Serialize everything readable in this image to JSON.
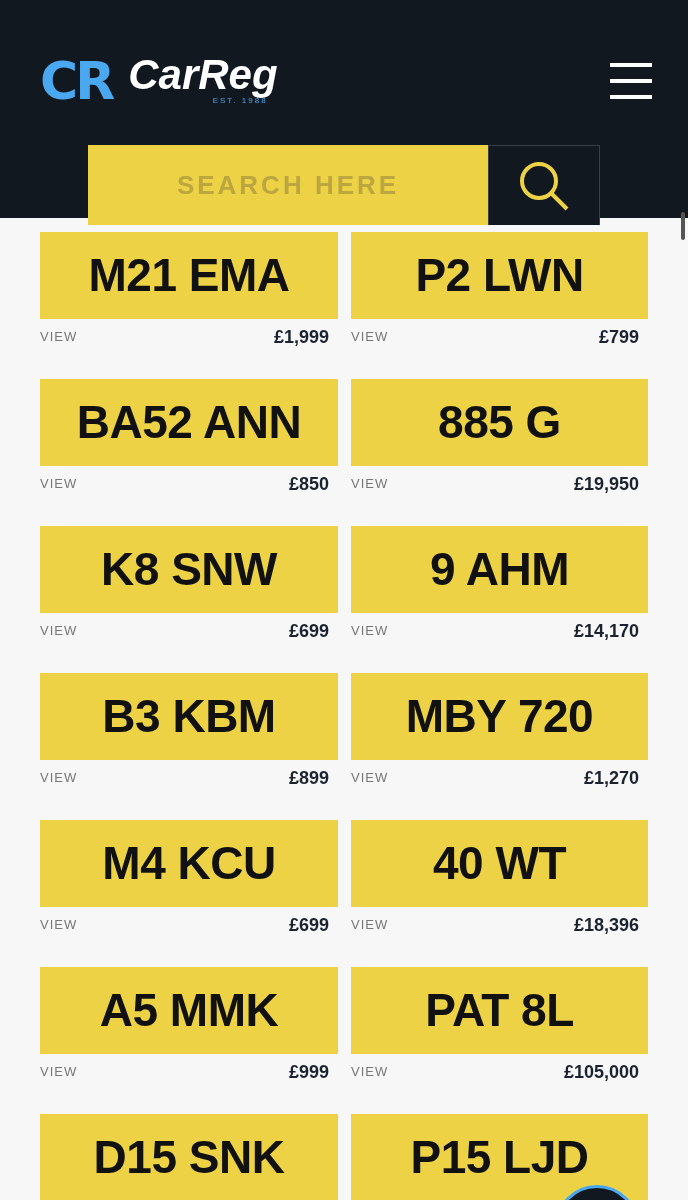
{
  "header": {
    "logo_mark": "CR",
    "logo_text": "CarReg",
    "logo_tagline": "EST. 1988"
  },
  "search": {
    "placeholder": "SEARCH HERE"
  },
  "plates": [
    {
      "registration": "M21 EMA",
      "link": "VIEW",
      "price": "£1,999"
    },
    {
      "registration": "P2 LWN",
      "link": "VIEW",
      "price": "£799"
    },
    {
      "registration": "BA52 ANN",
      "link": "VIEW",
      "price": "£850"
    },
    {
      "registration": "885 G",
      "link": "VIEW",
      "price": "£19,950"
    },
    {
      "registration": "K8 SNW",
      "link": "VIEW",
      "price": "£699"
    },
    {
      "registration": "9 AHM",
      "link": "VIEW",
      "price": "£14,170"
    },
    {
      "registration": "B3 KBM",
      "link": "VIEW",
      "price": "£899"
    },
    {
      "registration": "MBY 720",
      "link": "VIEW",
      "price": "£1,270"
    },
    {
      "registration": "M4 KCU",
      "link": "VIEW",
      "price": "£699"
    },
    {
      "registration": "40 WT",
      "link": "VIEW",
      "price": "£18,396"
    },
    {
      "registration": "A5 MMK",
      "link": "VIEW",
      "price": "£999"
    },
    {
      "registration": "PAT 8L",
      "link": "VIEW",
      "price": "£105,000"
    },
    {
      "registration": "D15 SNK"
    },
    {
      "registration": "P15 LJD"
    }
  ]
}
